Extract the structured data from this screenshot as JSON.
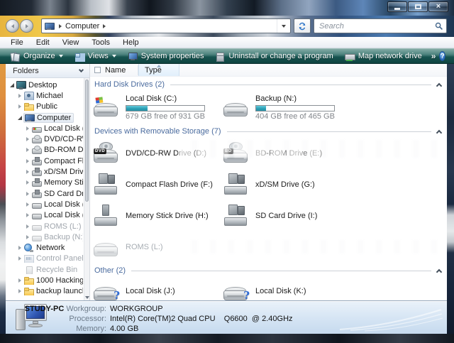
{
  "titlebar": {
    "controls": [
      "minimize",
      "maximize",
      "close"
    ]
  },
  "address_bar": {
    "path_item": "Computer",
    "search_placeholder": "Search"
  },
  "menu": {
    "items": [
      "File",
      "Edit",
      "View",
      "Tools",
      "Help"
    ]
  },
  "toolbar": {
    "items": [
      {
        "label": "Organize",
        "icon": "organize",
        "dropdown": true
      },
      {
        "label": "Views",
        "icon": "views",
        "dropdown": true
      },
      {
        "label": "System properties",
        "icon": "sysprop",
        "dropdown": false
      },
      {
        "label": "Uninstall or change a program",
        "icon": "uninstall",
        "dropdown": false
      },
      {
        "label": "Map network drive",
        "icon": "mapdrive",
        "dropdown": false
      }
    ],
    "overflow_glyph": "»",
    "help_glyph": "?"
  },
  "sidebar": {
    "header": "Folders",
    "items": [
      {
        "label": "Desktop",
        "depth": 0,
        "icon": "desktop",
        "state": "expanded"
      },
      {
        "label": "Michael",
        "depth": 1,
        "icon": "user",
        "state": "collapsed"
      },
      {
        "label": "Public",
        "depth": 1,
        "icon": "folder",
        "state": "collapsed"
      },
      {
        "label": "Computer",
        "depth": 1,
        "icon": "computer",
        "state": "expanded",
        "selected": true
      },
      {
        "label": "Local Disk (C",
        "depth": 2,
        "icon": "hdd-win",
        "state": "collapsed"
      },
      {
        "label": "DVD/CD-RW",
        "depth": 2,
        "icon": "optical",
        "state": "collapsed"
      },
      {
        "label": "BD-ROM Dri",
        "depth": 2,
        "icon": "optical",
        "state": "collapsed"
      },
      {
        "label": "Compact Fla",
        "depth": 2,
        "icon": "reader",
        "state": "collapsed"
      },
      {
        "label": "xD/SM Drive",
        "depth": 2,
        "icon": "reader",
        "state": "collapsed"
      },
      {
        "label": "Memory Stic",
        "depth": 2,
        "icon": "reader",
        "state": "collapsed"
      },
      {
        "label": "SD Card Driv",
        "depth": 2,
        "icon": "reader",
        "state": "collapsed"
      },
      {
        "label": "Local Disk (J:",
        "depth": 2,
        "icon": "hdd",
        "state": "collapsed"
      },
      {
        "label": "Local Disk (K",
        "depth": 2,
        "icon": "hdd",
        "state": "collapsed"
      },
      {
        "label": "ROMS (L:)",
        "depth": 2,
        "icon": "hdd",
        "state": "collapsed",
        "dimmed": true
      },
      {
        "label": "Backup (N:)",
        "depth": 2,
        "icon": "hdd",
        "state": "collapsed",
        "dimmed": true
      },
      {
        "label": "Network",
        "depth": 1,
        "icon": "network",
        "state": "collapsed"
      },
      {
        "label": "Control Panel",
        "depth": 1,
        "icon": "control",
        "state": "collapsed",
        "dimmed": true
      },
      {
        "label": "Recycle Bin",
        "depth": 1,
        "icon": "recycle",
        "state": "leaf",
        "dimmed": true
      },
      {
        "label": "1000 Hacking",
        "depth": 1,
        "icon": "folder",
        "state": "collapsed"
      },
      {
        "label": "backup launch",
        "depth": 1,
        "icon": "folder",
        "state": "collapsed"
      }
    ]
  },
  "main": {
    "columns": {
      "name": "Name",
      "type": "Type"
    },
    "sections": [
      {
        "title": "Hard Disk Drives (2)",
        "items": [
          {
            "name": "Local Disk (C:)",
            "icon": "hdd-windows",
            "usage_percent": 27,
            "free_text": "679 GB free of 931 GB"
          },
          {
            "name": "Backup (N:)",
            "icon": "hdd",
            "usage_percent": 13,
            "free_text": "404 GB free of 465 GB"
          }
        ]
      },
      {
        "title": "Devices with Removable Storage (7)",
        "items": [
          {
            "name": "DVD/CD-RW Drive (D:)",
            "icon": "optical",
            "badge": "DVD"
          },
          {
            "name": "BD-ROM Drive (E:)",
            "icon": "optical",
            "badge": "BD"
          },
          {
            "name": "Compact Flash Drive (F:)",
            "icon": "card-reader"
          },
          {
            "name": "xD/SM Drive (G:)",
            "icon": "card-reader"
          },
          {
            "name": "Memory Stick Drive (H:)",
            "icon": "memory-stick"
          },
          {
            "name": "SD Card Drive (I:)",
            "icon": "card-reader"
          },
          {
            "name": "ROMS (L:)",
            "icon": "hdd",
            "dimmed": true
          }
        ]
      },
      {
        "title": "Other (2)",
        "items": [
          {
            "name": "Local Disk (J:)",
            "icon": "hdd-question",
            "badge": "?"
          },
          {
            "name": "Local Disk (K:)",
            "icon": "hdd-question",
            "badge": "?"
          }
        ]
      }
    ]
  },
  "details": {
    "computer_name": "STUDY-PC",
    "rows": [
      {
        "label": "Workgroup:",
        "value": "WORKGROUP"
      },
      {
        "label": "Processor:",
        "value": "Intel(R) Core(TM)2 Quad CPU    Q6600  @ 2.40GHz"
      },
      {
        "label": "Memory:",
        "value": "4.00 GB"
      }
    ]
  },
  "colors": {
    "toolbar_top": "#83aca6",
    "toolbar_bottom": "#0f4340",
    "usage_fill": "#2d9fb4",
    "section_title": "#4a6b9e",
    "details_bg": "#d3e3f3"
  }
}
